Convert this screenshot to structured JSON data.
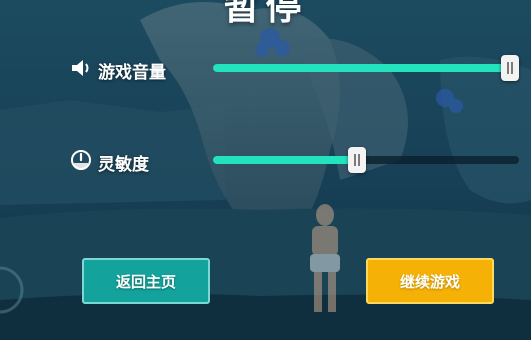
{
  "pause_menu": {
    "title": "暂停",
    "volume": {
      "label": "游戏音量",
      "icon": "speaker-icon",
      "level": 1.0
    },
    "sensitivity": {
      "label": "灵敏度",
      "icon": "gauge-icon",
      "level": 0.47
    },
    "buttons": {
      "home_label": "返回主页",
      "continue_label": "继续游戏"
    }
  },
  "colors": {
    "slider_fill": "#22e3bd",
    "home_button": "#13a39c",
    "continue_button": "#f5b106"
  }
}
